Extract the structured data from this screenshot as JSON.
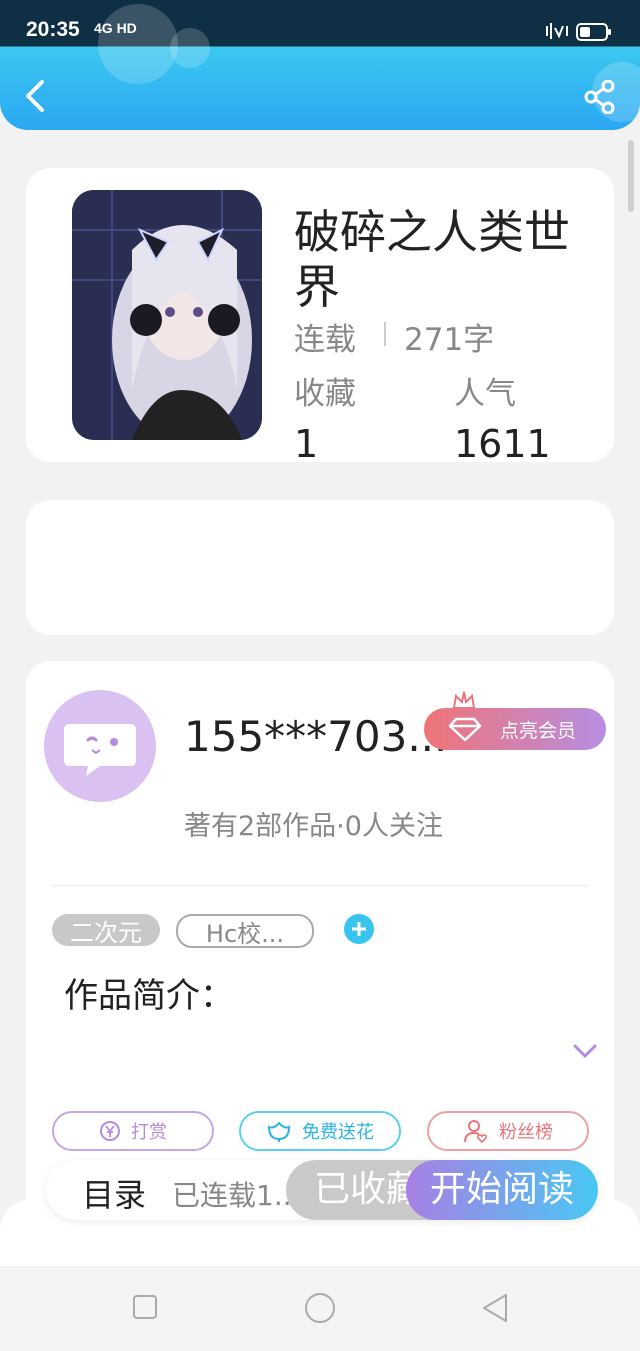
{
  "status": {
    "time": "20:35",
    "network": "4G HD"
  },
  "book": {
    "title": "破碎之人类世界",
    "status": "连载",
    "word_count": "271字",
    "favorites_label": "收藏",
    "favorites_value": "1",
    "popularity_label": "人气",
    "popularity_value": "1611"
  },
  "author": {
    "name": "155***703...",
    "vip_label": "点亮会员",
    "info": "著有2部作品·0人关注"
  },
  "tags": [
    "二次元",
    "Hc校..."
  ],
  "intro_label": "作品简介：",
  "actions": {
    "reward": "打赏",
    "flower": "免费送花",
    "fans": "粉丝榜"
  },
  "bottom": {
    "catalog": "目录",
    "serialized": "已连载1...",
    "collected": "已收藏",
    "read": "开始阅读"
  },
  "colors": {
    "accent": "#2aa7f3",
    "purple": "#b58be0",
    "pink": "#e9757a"
  }
}
